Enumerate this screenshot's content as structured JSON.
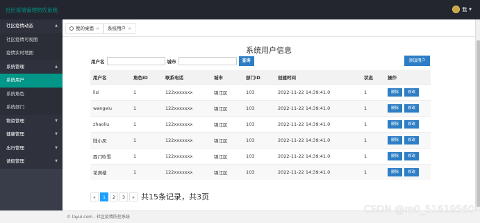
{
  "app": {
    "title": "社区疫情管理防控系统",
    "user": "我"
  },
  "sidebar": [
    {
      "label": "社区疫情动态",
      "type": "group",
      "arrow": "▲"
    },
    {
      "label": "社区疫情可视图",
      "type": "sub"
    },
    {
      "label": "疫情实时地图",
      "type": "sub"
    },
    {
      "label": "系统管理",
      "type": "group",
      "arrow": "▲"
    },
    {
      "label": "系统用户",
      "type": "active"
    },
    {
      "label": "系统角色",
      "type": "sub"
    },
    {
      "label": "系统部门",
      "type": "sub"
    },
    {
      "label": "物资管理",
      "type": "group",
      "arrow": "▼"
    },
    {
      "label": "健康管理",
      "type": "group",
      "arrow": "▼"
    },
    {
      "label": "出行管理",
      "type": "group",
      "arrow": "▼"
    },
    {
      "label": "请假管理",
      "type": "group",
      "arrow": "▼"
    }
  ],
  "tabs": {
    "home": "我的桌面",
    "current": "系统用户",
    "close": "×"
  },
  "page": {
    "title": "系统用户信息"
  },
  "filter": {
    "username_label": "用户名",
    "username_value": "",
    "city_label": "城市",
    "city_value": "",
    "query_label": "查询"
  },
  "add_button": "添加用户",
  "table": {
    "headers": [
      "用户名",
      "角色ID",
      "联系电话",
      "城市",
      "部门ID",
      "创建时间",
      "状态",
      "操作"
    ],
    "delete_label": "删除",
    "edit_label": "修改",
    "rows": [
      [
        "lisi",
        "1",
        "122xxxxxxx",
        "锦江区",
        "103",
        "2022-11-22 14:39:41.0",
        "1"
      ],
      [
        "wangwu",
        "1",
        "122xxxxxxx",
        "锦江区",
        "103",
        "2022-11-22 14:39:41.0",
        "1"
      ],
      [
        "zhaoliu",
        "1",
        "122xxxxxxx",
        "锦江区",
        "103",
        "2022-11-22 14:39:41.0",
        "1"
      ],
      [
        "陆小凤",
        "1",
        "122xxxxxxx",
        "锦江区",
        "103",
        "2022-11-22 14:39:41.0",
        "1"
      ],
      [
        "西门吹雪",
        "1",
        "122xxxxxxx",
        "锦江区",
        "103",
        "2022-11-22 14:39:41.0",
        "1"
      ],
      [
        "花满楼",
        "1",
        "122xxxxxxx",
        "锦江区",
        "103",
        "2022-11-22 14:39:41.0",
        "1"
      ]
    ]
  },
  "pager": {
    "prev": "«",
    "pages": [
      "1",
      "2",
      "3"
    ],
    "current": "1",
    "next": "»",
    "summary": "共15条记录，共3页"
  },
  "footer": "© layui.com - 社区疫情防控系统",
  "watermark": "CSDN @m0_51619560",
  "colors": {
    "accent": "#009688",
    "primary": "#1e9fff",
    "header": "#23262e",
    "sidebar": "#393d49"
  }
}
